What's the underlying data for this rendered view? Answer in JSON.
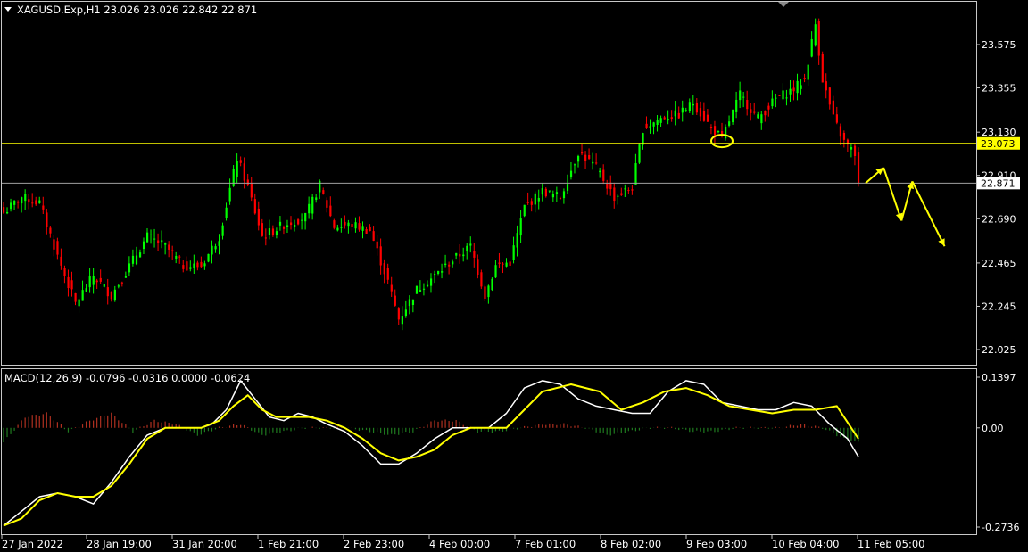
{
  "header": {
    "symbol_line": "XAGUSD.Exp,H1  23.026 23.026 22.842 22.871"
  },
  "indicator": {
    "macd_line": "MACD(12,26,9) -0.0796 -0.0316 0.0000 -0.0624"
  },
  "colors": {
    "background": "#000000",
    "bull_candle": "#00ff00",
    "bear_candle": "#ff0000",
    "level_line": "#ffff00",
    "bid_line": "#a0a0a0",
    "macd_main": "#ffffff",
    "macd_signal": "#ffff00",
    "hist_positive": "#b03020",
    "hist_negative": "#1f7a1f",
    "annotation": "#ffff00"
  },
  "price_axis": {
    "ticks": [
      "23.575",
      "23.355",
      "23.130",
      "22.910",
      "22.690",
      "22.465",
      "22.245",
      "22.025"
    ],
    "level_label": "23.073",
    "bid_label": "22.871"
  },
  "macd_axis": {
    "ticks": [
      "0.1397",
      "0.00",
      "-0.2736"
    ]
  },
  "time_axis": {
    "labels": [
      "27 Jan 2022",
      "28 Jan 19:00",
      "31 Jan 20:00",
      "1 Feb 21:00",
      "2 Feb 23:00",
      "4 Feb 00:00",
      "7 Feb 01:00",
      "8 Feb 02:00",
      "9 Feb 03:00",
      "10 Feb 04:00",
      "11 Feb 05:00"
    ]
  },
  "chart_data": [
    {
      "type": "candlestick",
      "title": "XAGUSD.Exp,H1",
      "timeframe": "H1",
      "last_bar": {
        "open": 23.026,
        "high": 23.026,
        "low": 22.842,
        "close": 22.871
      },
      "ylim": [
        21.95,
        23.76
      ],
      "x_tick_labels": [
        "27 Jan 2022",
        "28 Jan 19:00",
        "31 Jan 20:00",
        "1 Feb 21:00",
        "2 Feb 23:00",
        "4 Feb 00:00",
        "7 Feb 01:00",
        "8 Feb 02:00",
        "9 Feb 03:00",
        "10 Feb 04:00",
        "11 Feb 05:00"
      ],
      "y_ticks": [
        23.575,
        23.355,
        23.13,
        22.91,
        22.69,
        22.465,
        22.245,
        22.025
      ],
      "horizontal_lines": [
        {
          "value": 23.073,
          "label": "23.073"
        },
        {
          "value": 22.871,
          "label": "22.871"
        }
      ],
      "close_path": [
        {
          "bar": 0,
          "close": 22.72
        },
        {
          "bar": 5,
          "close": 22.8
        },
        {
          "bar": 10,
          "close": 22.77
        },
        {
          "bar": 15,
          "close": 22.5
        },
        {
          "bar": 20,
          "close": 22.26
        },
        {
          "bar": 25,
          "close": 22.4
        },
        {
          "bar": 30,
          "close": 22.3
        },
        {
          "bar": 35,
          "close": 22.45
        },
        {
          "bar": 40,
          "close": 22.6
        },
        {
          "bar": 45,
          "close": 22.55
        },
        {
          "bar": 50,
          "close": 22.45
        },
        {
          "bar": 55,
          "close": 22.45
        },
        {
          "bar": 60,
          "close": 22.6
        },
        {
          "bar": 65,
          "close": 23.0
        },
        {
          "bar": 68,
          "close": 22.85
        },
        {
          "bar": 72,
          "close": 22.6
        },
        {
          "bar": 78,
          "close": 22.66
        },
        {
          "bar": 84,
          "close": 22.7
        },
        {
          "bar": 88,
          "close": 22.86
        },
        {
          "bar": 92,
          "close": 22.65
        },
        {
          "bar": 97,
          "close": 22.66
        },
        {
          "bar": 102,
          "close": 22.63
        },
        {
          "bar": 107,
          "close": 22.37
        },
        {
          "bar": 110,
          "close": 22.18
        },
        {
          "bar": 115,
          "close": 22.33
        },
        {
          "bar": 120,
          "close": 22.4
        },
        {
          "bar": 125,
          "close": 22.48
        },
        {
          "bar": 130,
          "close": 22.55
        },
        {
          "bar": 134,
          "close": 22.3
        },
        {
          "bar": 137,
          "close": 22.45
        },
        {
          "bar": 141,
          "close": 22.47
        },
        {
          "bar": 145,
          "close": 22.75
        },
        {
          "bar": 150,
          "close": 22.83
        },
        {
          "bar": 155,
          "close": 22.8
        },
        {
          "bar": 160,
          "close": 23.03
        },
        {
          "bar": 165,
          "close": 22.95
        },
        {
          "bar": 170,
          "close": 22.8
        },
        {
          "bar": 175,
          "close": 22.85
        },
        {
          "bar": 178,
          "close": 23.15
        },
        {
          "bar": 183,
          "close": 23.2
        },
        {
          "bar": 188,
          "close": 23.22
        },
        {
          "bar": 192,
          "close": 23.28
        },
        {
          "bar": 197,
          "close": 23.15
        },
        {
          "bar": 200,
          "close": 23.1
        },
        {
          "bar": 205,
          "close": 23.32
        },
        {
          "bar": 210,
          "close": 23.2
        },
        {
          "bar": 215,
          "close": 23.3
        },
        {
          "bar": 220,
          "close": 23.35
        },
        {
          "bar": 223,
          "close": 23.4
        },
        {
          "bar": 226,
          "close": 23.68
        },
        {
          "bar": 228,
          "close": 23.4
        },
        {
          "bar": 231,
          "close": 23.2
        },
        {
          "bar": 234,
          "close": 23.08
        },
        {
          "bar": 237,
          "close": 23.02
        },
        {
          "bar": 238,
          "close": 22.871
        }
      ],
      "forecast_arrow_path": [
        22.871,
        22.95,
        22.68,
        22.88,
        22.55
      ]
    },
    {
      "type": "line",
      "title": "MACD(12,26,9)",
      "ylim": [
        -0.2736,
        0.1397
      ],
      "y_ticks": [
        0.1397,
        0.0,
        -0.2736
      ],
      "readout": {
        "main": -0.0796,
        "signal": -0.0316,
        "value3": 0.0,
        "value4": -0.0624
      },
      "series": [
        {
          "values": [
            -0.27,
            -0.23,
            -0.19,
            -0.18,
            -0.19,
            -0.21,
            -0.15,
            -0.08,
            -0.02,
            0.0,
            0.0,
            0.0,
            0.01,
            0.05,
            0.13,
            0.08,
            0.03,
            0.02,
            0.04,
            0.03,
            0.01,
            -0.01,
            -0.05,
            -0.1,
            -0.1,
            -0.07,
            -0.03,
            0.0,
            0.0,
            0.0,
            0.04,
            0.11,
            0.13,
            0.12,
            0.08,
            0.06,
            0.05,
            0.04,
            0.04,
            0.1,
            0.13,
            0.12,
            0.07,
            0.06,
            0.05,
            0.05,
            0.07,
            0.06,
            0.01,
            -0.03,
            -0.08
          ],
          "x_bars": [
            0,
            5,
            10,
            15,
            20,
            25,
            30,
            35,
            40,
            45,
            50,
            55,
            58,
            62,
            66,
            70,
            74,
            78,
            82,
            86,
            90,
            95,
            100,
            105,
            110,
            115,
            120,
            125,
            130,
            135,
            140,
            145,
            150,
            155,
            160,
            165,
            170,
            175,
            180,
            185,
            190,
            195,
            200,
            205,
            210,
            215,
            220,
            225,
            230,
            235,
            238
          ]
        },
        {
          "values": [
            -0.27,
            -0.25,
            -0.2,
            -0.18,
            -0.19,
            -0.19,
            -0.16,
            -0.1,
            -0.03,
            0.0,
            0.0,
            0.0,
            0.02,
            0.06,
            0.09,
            0.05,
            0.03,
            0.03,
            0.03,
            0.02,
            0.0,
            -0.03,
            -0.07,
            -0.09,
            -0.08,
            -0.06,
            -0.02,
            0.0,
            0.0,
            0.0,
            0.05,
            0.1,
            0.12,
            0.1,
            0.05,
            0.07,
            0.1,
            0.11,
            0.09,
            0.06,
            0.05,
            0.04,
            0.05,
            0.05,
            0.06,
            0.0,
            -0.03
          ],
          "x_bars": [
            0,
            5,
            10,
            15,
            20,
            25,
            30,
            35,
            40,
            45,
            50,
            55,
            60,
            64,
            68,
            72,
            76,
            80,
            85,
            90,
            95,
            100,
            105,
            110,
            115,
            120,
            125,
            130,
            135,
            140,
            145,
            150,
            158,
            166,
            172,
            178,
            184,
            190,
            196,
            202,
            208,
            214,
            220,
            226,
            232,
            236,
            238
          ]
        }
      ],
      "histogram": {
        "x_bars": [
          0,
          6,
          12,
          18,
          24,
          30,
          36,
          42,
          48,
          54,
          60,
          66,
          72,
          78,
          84,
          90,
          96,
          102,
          108,
          114,
          120,
          126,
          132,
          138,
          144,
          150,
          156,
          162,
          168,
          174,
          180,
          186,
          192,
          198,
          204,
          210,
          216,
          222,
          228,
          234,
          238
        ],
        "values": [
          -0.04,
          0.03,
          0.04,
          -0.01,
          0.02,
          0.04,
          -0.01,
          0.02,
          0.01,
          -0.02,
          0.0,
          0.01,
          -0.02,
          -0.01,
          0.0,
          0.0,
          0.0,
          -0.01,
          -0.02,
          -0.01,
          0.02,
          0.02,
          -0.01,
          -0.01,
          0.0,
          0.01,
          0.01,
          0.0,
          -0.02,
          -0.01,
          0.0,
          0.0,
          -0.01,
          -0.01,
          0.0,
          0.0,
          0.0,
          0.01,
          0.0,
          -0.03,
          -0.04
        ]
      }
    }
  ]
}
